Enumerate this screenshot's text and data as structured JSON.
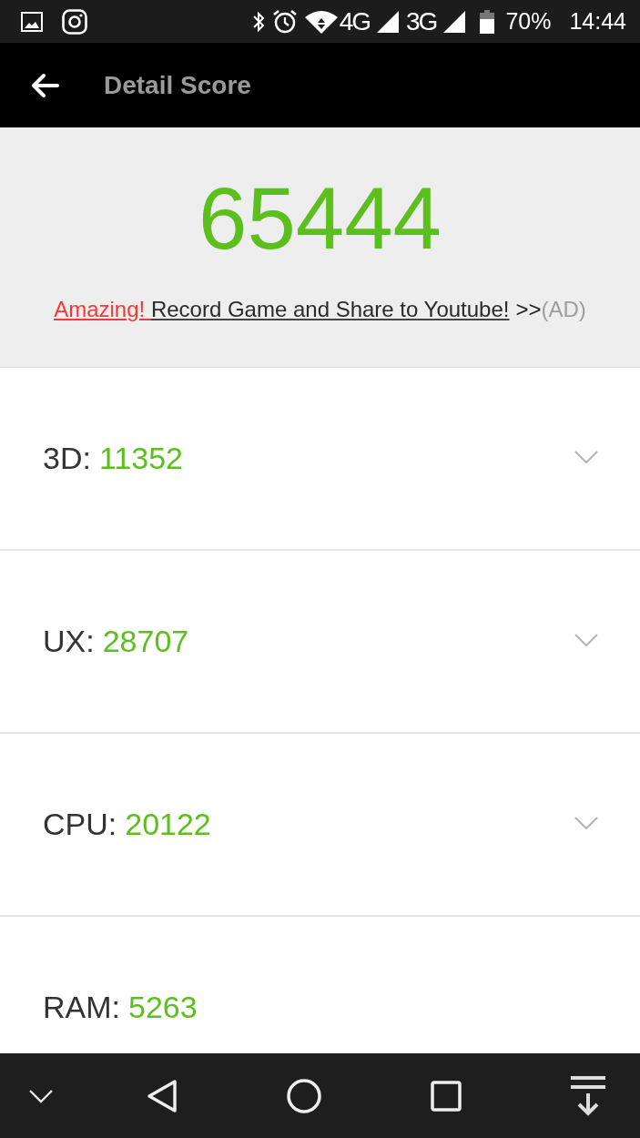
{
  "status_bar": {
    "network_1": "4G",
    "network_2": "3G",
    "battery": "70%",
    "time": "14:44"
  },
  "toolbar": {
    "title": "Detail Score"
  },
  "total": {
    "score": "65444",
    "ad": {
      "highlight": "Amazing!",
      "link": "Record Game and Share to Youtube!",
      "arrows": ">>",
      "tag": "(AD)"
    }
  },
  "scores": [
    {
      "label": "3D:",
      "value": "11352",
      "kind": "expandable"
    },
    {
      "label": "UX:",
      "value": "28707",
      "kind": "expandable"
    },
    {
      "label": "CPU:",
      "value": "20122",
      "kind": "expandable"
    },
    {
      "label": "RAM:",
      "value": "5263",
      "kind": "plain"
    }
  ]
}
